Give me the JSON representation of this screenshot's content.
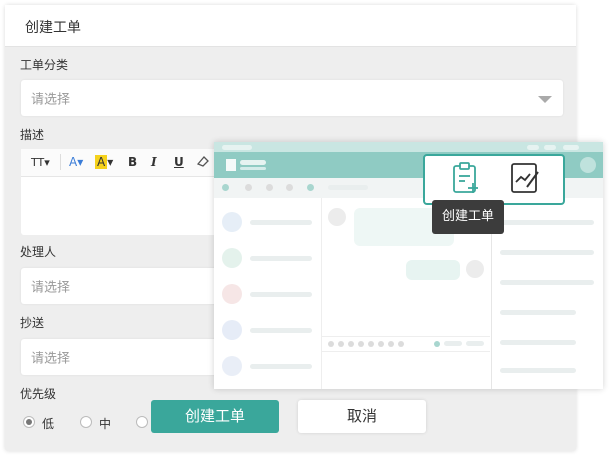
{
  "panel": {
    "title": "创建工单"
  },
  "fields": {
    "category": {
      "label": "工单分类",
      "placeholder": "请选择"
    },
    "description": {
      "label": "描述"
    },
    "assignee": {
      "label": "处理人",
      "placeholder": "请选择"
    },
    "cc": {
      "label": "抄送",
      "placeholder": "请选择"
    },
    "priority": {
      "label": "优先级",
      "options": [
        "低",
        "中",
        ""
      ],
      "selected": "低"
    }
  },
  "toolbar": {
    "font_size": "TT",
    "font_color": "A",
    "highlight": "A",
    "bold": "B",
    "italic": "I",
    "underline": "U"
  },
  "buttons": {
    "create": "创建工单",
    "cancel": "取消"
  },
  "tooltip": {
    "text": "创建工单"
  },
  "icons": {
    "brand_color": "#3aa79b",
    "create_ticket_icon": "clipboard-plus-icon",
    "edit_icon": "edit-document-icon"
  }
}
